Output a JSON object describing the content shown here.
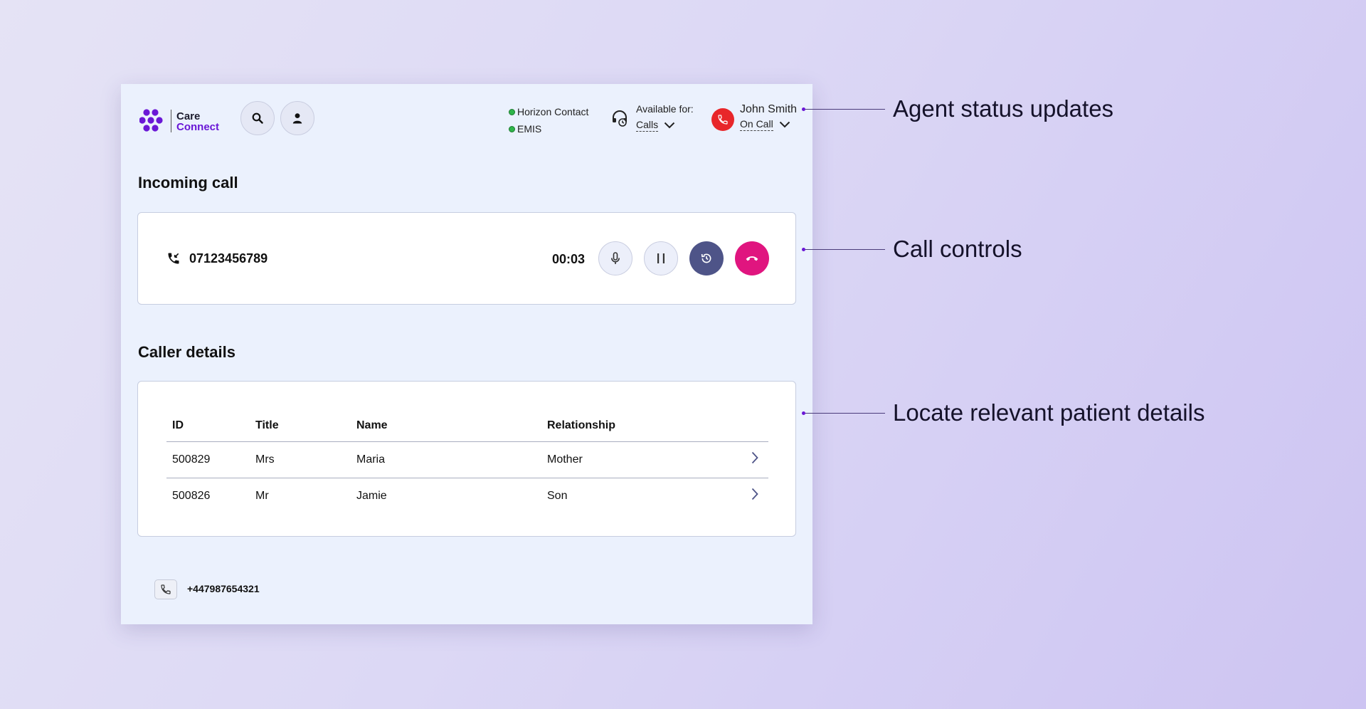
{
  "app": {
    "logo_top": "Care",
    "logo_bottom": "Connect"
  },
  "header": {
    "systems": [
      {
        "label": "Horizon Contact",
        "status_color": "#2fb54a"
      },
      {
        "label": "EMIS",
        "status_color": "#2fb54a"
      }
    ],
    "available_label": "Available for:",
    "available_value": "Calls",
    "agent_name": "John Smith",
    "agent_status": "On Call",
    "icons": [
      "search-icon",
      "user-icon",
      "headset-icon",
      "phone-icon",
      "chevron-down-icon"
    ]
  },
  "incoming": {
    "title": "Incoming call",
    "number": "07123456789",
    "timer": "00:03",
    "controls": [
      "mute",
      "hold",
      "history",
      "end-call"
    ]
  },
  "caller": {
    "title": "Caller details",
    "columns": [
      "ID",
      "Title",
      "Name",
      "Relationship"
    ],
    "rows": [
      [
        "500829",
        "Mrs",
        "Maria",
        "Mother"
      ],
      [
        "500826",
        "Mr",
        "Jamie",
        "Son"
      ]
    ]
  },
  "footer": {
    "number": "+447987654321"
  },
  "annotations": [
    "Agent status updates",
    "Call controls",
    "Locate relevant patient details"
  ],
  "colors": {
    "brand": "#6a17d6",
    "end_call": "#e0157f",
    "history_button": "#4e5488",
    "agent_status": "#e8262a"
  }
}
